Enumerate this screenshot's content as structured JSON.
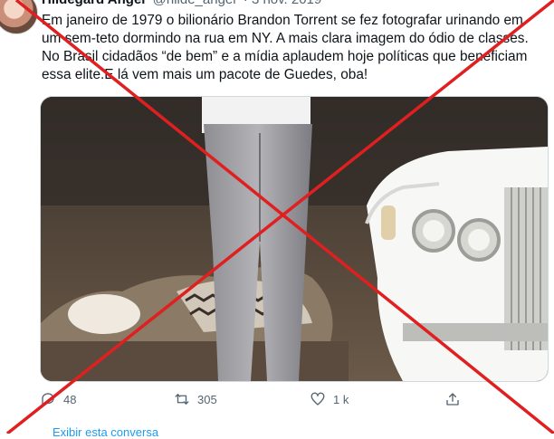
{
  "tweet": {
    "author_name": "Hildegard Angel",
    "author_handle": "@hilde_angel",
    "date": "· 3 nov. 2019",
    "text": "Em janeiro de 1979 o bilionário Brandon Torrent se fez fotografar urinando em um sem-teto dormindo na rua em NY. A mais clara imagem do ódio de classes. No Brasil cidadãos “de bem” e a mídia aplaudem hoje políticas que beneficiam essa elite.E lá vem mais um pacote de Guedes, oba!"
  },
  "actions": {
    "reply_count": "48",
    "retweet_count": "305",
    "like_count": "1 k"
  },
  "footer": {
    "link_text": "Exibir esta conversa"
  },
  "overlay": {
    "color": "#e02020"
  }
}
